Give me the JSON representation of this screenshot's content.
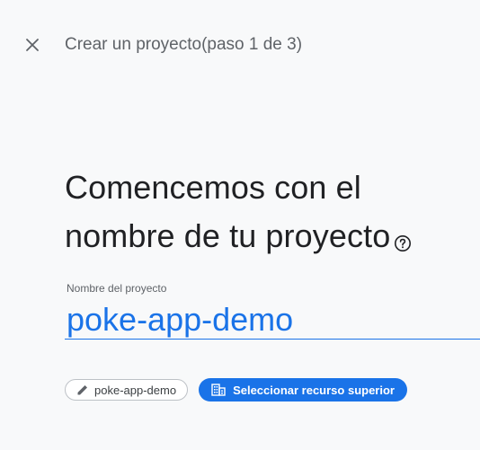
{
  "header": {
    "close_icon": "close-icon",
    "step_title": "Crear un proyecto(paso 1 de 3)"
  },
  "main": {
    "headline_line1": "Comencemos con el",
    "headline_line2": "nombre de tu proyecto",
    "help_icon": "help-circle-icon"
  },
  "project_name_field": {
    "label": "Nombre del proyecto",
    "value": "poke-app-demo"
  },
  "chips": {
    "project_id_icon": "pencil-icon",
    "project_id_label": "poke-app-demo",
    "parent_icon": "organization-building-icon",
    "parent_label": "Seleccionar recurso superior"
  },
  "colors": {
    "accent": "#1a73e8",
    "text_primary": "#202124",
    "text_secondary": "#5f6368",
    "background": "#f8f9fa"
  }
}
